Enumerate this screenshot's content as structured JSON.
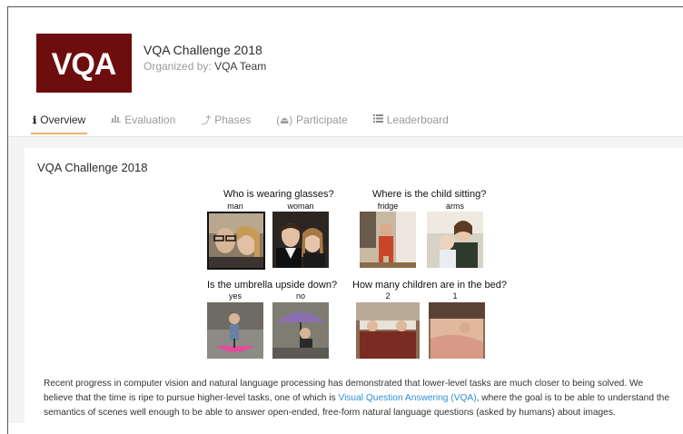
{
  "header": {
    "title": "VQA Challenge 2018",
    "organized_by_label": "Organized by:",
    "organizer": "VQA Team",
    "logo_text": "VQA"
  },
  "tabs": [
    {
      "label": "Overview",
      "icon": "info-icon",
      "active": true
    },
    {
      "label": "Evaluation",
      "icon": "bar-chart-icon",
      "active": false
    },
    {
      "label": "Phases",
      "icon": "phases-icon",
      "active": false
    },
    {
      "label": "Participate",
      "icon": "participate-icon",
      "active": false
    },
    {
      "label": "Leaderboard",
      "icon": "list-icon",
      "active": false
    }
  ],
  "overview": {
    "section_title": "VQA Challenge 2018",
    "figure": {
      "q1": {
        "question": "Who is wearing glasses?",
        "a1": "man",
        "a2": "woman"
      },
      "q2": {
        "question": "Where is the child sitting?",
        "a1": "fridge",
        "a2": "arms"
      },
      "q3": {
        "question": "Is the umbrella upside down?",
        "a1": "yes",
        "a2": "no"
      },
      "q4": {
        "question": "How many children are in the bed?",
        "a1": "2",
        "a2": "1"
      }
    },
    "desc_part1": "Recent progress in computer vision and natural language processing has demonstrated that lower-level tasks are much closer to being solved. We believe that the time is ripe to pursue higher-level tasks, one of which is ",
    "desc_link": "Visual Question Answering (VQA)",
    "desc_part2": ", where the goal is to be able to understand the semantics of scenes well enough to be able to answer open-ended, free-form natural language questions (asked by humans) about images."
  },
  "colors": {
    "logo_bg": "#6e0d0d",
    "active_tab_underline": "#e7b575",
    "link": "#2f8fd6"
  }
}
